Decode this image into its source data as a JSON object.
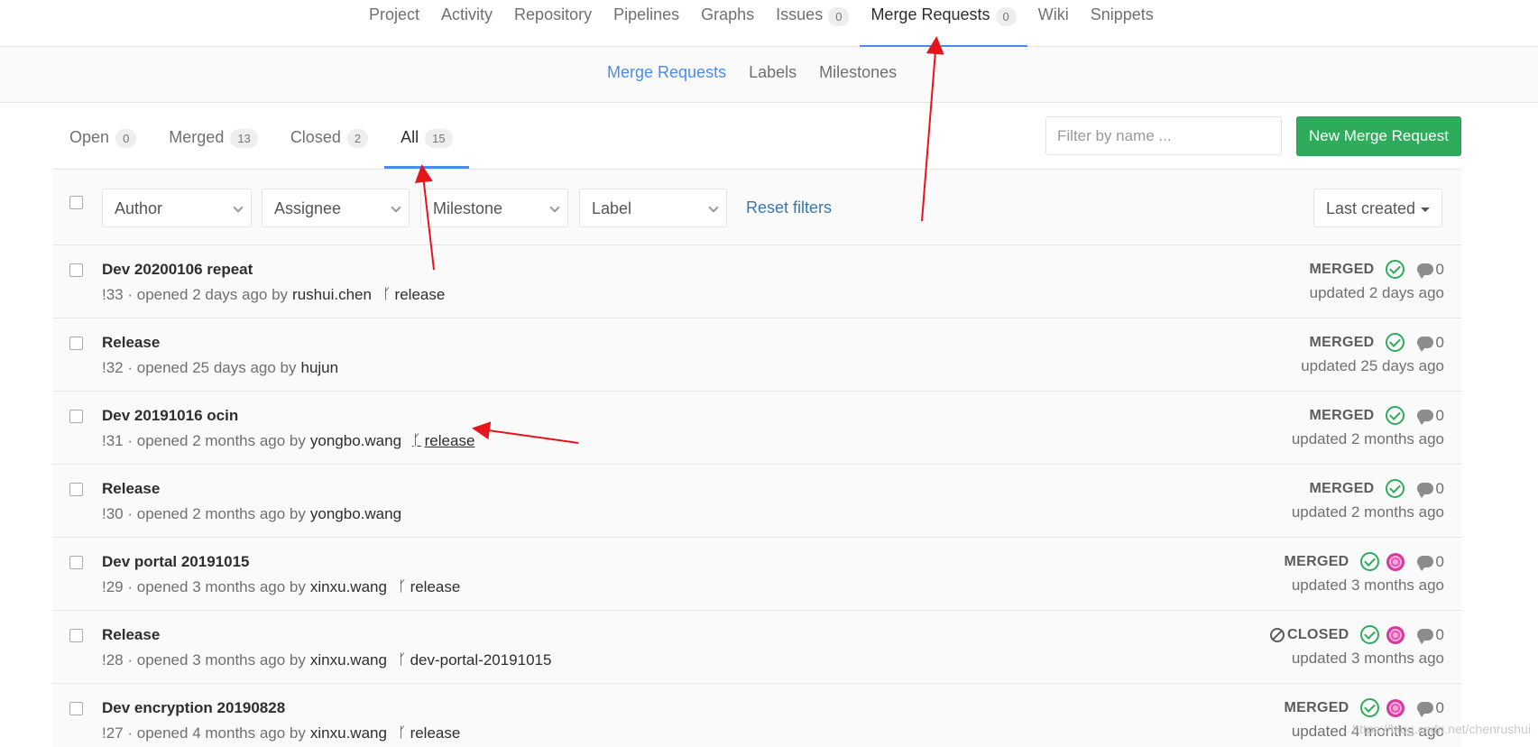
{
  "top_nav": {
    "items": [
      {
        "label": "Project"
      },
      {
        "label": "Activity"
      },
      {
        "label": "Repository"
      },
      {
        "label": "Pipelines"
      },
      {
        "label": "Graphs"
      },
      {
        "label": "Issues",
        "badge": "0"
      },
      {
        "label": "Merge Requests",
        "badge": "0",
        "active": true
      },
      {
        "label": "Wiki"
      },
      {
        "label": "Snippets"
      }
    ]
  },
  "sub_nav": {
    "items": [
      "Merge Requests",
      "Labels",
      "Milestones"
    ]
  },
  "state_tabs": [
    {
      "label": "Open",
      "count": "0"
    },
    {
      "label": "Merged",
      "count": "13"
    },
    {
      "label": "Closed",
      "count": "2"
    },
    {
      "label": "All",
      "count": "15",
      "active": true
    }
  ],
  "filter": {
    "placeholder": "Filter by name ...",
    "new_button": "New Merge Request",
    "author": "Author",
    "assignee": "Assignee",
    "milestone": "Milestone",
    "label": "Label",
    "reset": "Reset filters",
    "sort": "Last created"
  },
  "merge_requests": [
    {
      "title": "Dev 20200106 repeat",
      "meta": "!33 · opened 2 days ago by",
      "author": "rushui.chen",
      "branch": "release",
      "status": "MERGED",
      "comments": "0",
      "updated": "updated 2 days ago"
    },
    {
      "title": "Release",
      "meta": "!32 · opened 25 days ago by",
      "author": "hujun",
      "branch": "",
      "status": "MERGED",
      "comments": "0",
      "updated": "updated 25 days ago"
    },
    {
      "title": "Dev 20191016 ocin",
      "meta": "!31 · opened 2 months ago by",
      "author": "yongbo.wang",
      "branch": "release",
      "status": "MERGED",
      "comments": "0",
      "updated": "updated 2 months ago"
    },
    {
      "title": "Release",
      "meta": "!30 · opened 2 months ago by",
      "author": "yongbo.wang",
      "branch": "",
      "status": "MERGED",
      "comments": "0",
      "updated": "updated 2 months ago"
    },
    {
      "title": "Dev portal 20191015",
      "meta": "!29 · opened 3 months ago by",
      "author": "xinxu.wang",
      "branch": "release",
      "status": "MERGED",
      "comments": "0",
      "updated": "updated 3 months ago"
    },
    {
      "title": "Release",
      "meta": "!28 · opened 3 months ago by",
      "author": "xinxu.wang",
      "branch": "dev-portal-20191015",
      "status": "CLOSED",
      "comments": "0",
      "updated": "updated 3 months ago"
    },
    {
      "title": "Dev encryption 20190828",
      "meta": "!27 · opened 4 months ago by",
      "author": "xinxu.wang",
      "branch": "release",
      "status": "MERGED",
      "comments": "0",
      "updated": "updated 4 months ago"
    }
  ],
  "watermark": "https://blog.csdn.net/chenrushui",
  "colors": {
    "accent": "#4a8bee",
    "success": "#2eac5c",
    "link": "#3777b0",
    "arrow": "#e8141c"
  }
}
